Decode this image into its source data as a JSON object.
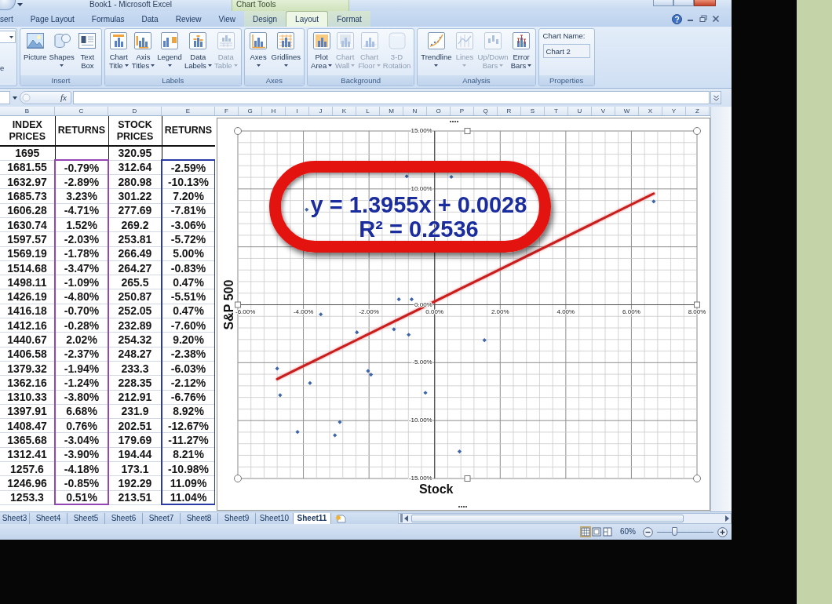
{
  "window": {
    "title": "Book1 - Microsoft Excel",
    "context_group": "Chart Tools"
  },
  "tabs": [
    {
      "label": "sert",
      "selected": false,
      "contextual": false
    },
    {
      "label": "Page Layout",
      "selected": false,
      "contextual": false
    },
    {
      "label": "Formulas",
      "selected": false,
      "contextual": false
    },
    {
      "label": "Data",
      "selected": false,
      "contextual": false
    },
    {
      "label": "Review",
      "selected": false,
      "contextual": false
    },
    {
      "label": "View",
      "selected": false,
      "contextual": false
    },
    {
      "label": "Design",
      "selected": false,
      "contextual": true
    },
    {
      "label": "Layout",
      "selected": true,
      "contextual": true
    },
    {
      "label": "Format",
      "selected": false,
      "contextual": true
    }
  ],
  "ribbon": {
    "cut_group": {
      "text": "e"
    },
    "groups": [
      {
        "label": "Insert",
        "buttons": [
          {
            "label": "Picture",
            "dropdown": false,
            "disabled": false
          },
          {
            "label": "Shapes",
            "dropdown": true,
            "disabled": false
          },
          {
            "label": "Text Box",
            "dropdown": false,
            "disabled": false
          }
        ]
      },
      {
        "label": "Labels",
        "buttons": [
          {
            "label": "Chart Title",
            "dropdown": true,
            "disabled": false
          },
          {
            "label": "Axis Titles",
            "dropdown": true,
            "disabled": false
          },
          {
            "label": "Legend",
            "dropdown": true,
            "disabled": false
          },
          {
            "label": "Data Labels",
            "dropdown": true,
            "disabled": false
          },
          {
            "label": "Data Table",
            "dropdown": true,
            "disabled": true
          }
        ]
      },
      {
        "label": "Axes",
        "buttons": [
          {
            "label": "Axes",
            "dropdown": true,
            "disabled": false
          },
          {
            "label": "Gridlines",
            "dropdown": true,
            "disabled": false
          }
        ]
      },
      {
        "label": "Background",
        "buttons": [
          {
            "label": "Plot Area",
            "dropdown": true,
            "disabled": false
          },
          {
            "label": "Chart Wall",
            "dropdown": true,
            "disabled": true
          },
          {
            "label": "Chart Floor",
            "dropdown": true,
            "disabled": true
          },
          {
            "label": "3-D Rotation",
            "dropdown": false,
            "disabled": true
          }
        ]
      },
      {
        "label": "Analysis",
        "buttons": [
          {
            "label": "Trendline",
            "dropdown": true,
            "disabled": false
          },
          {
            "label": "Lines",
            "dropdown": true,
            "disabled": true
          },
          {
            "label": "Up/Down Bars",
            "dropdown": true,
            "disabled": true
          },
          {
            "label": "Error Bars",
            "dropdown": true,
            "disabled": false
          }
        ]
      }
    ],
    "properties": {
      "label": "Properties",
      "field_label": "Chart Name:",
      "value": "Chart 2"
    }
  },
  "formula_bar": {
    "function_label": "fx"
  },
  "column_headers": [
    "B",
    "C",
    "D",
    "E",
    "F",
    "G",
    "H",
    "I",
    "J",
    "K",
    "L",
    "M",
    "N",
    "O",
    "P",
    "Q",
    "R",
    "S",
    "T",
    "U",
    "V",
    "W",
    "X",
    "Y",
    "Z"
  ],
  "table": {
    "columns": [
      {
        "label": "INDEX PRICES"
      },
      {
        "label": "RETURNS",
        "color": "#9446b4"
      },
      {
        "label": "STOCK PRICES"
      },
      {
        "label": "RETURNS",
        "color": "#2a3aa6"
      }
    ],
    "rows": [
      [
        "1695",
        null,
        "320.95",
        null
      ],
      [
        "1681.55",
        "-0.79%",
        "312.64",
        "-2.59%"
      ],
      [
        "1632.97",
        "-2.89%",
        "280.98",
        "-10.13%"
      ],
      [
        "1685.73",
        "3.23%",
        "301.22",
        "7.20%"
      ],
      [
        "1606.28",
        "-4.71%",
        "277.69",
        "-7.81%"
      ],
      [
        "1630.74",
        "1.52%",
        "269.2",
        "-3.06%"
      ],
      [
        "1597.57",
        "-2.03%",
        "253.81",
        "-5.72%"
      ],
      [
        "1569.19",
        "-1.78%",
        "266.49",
        "5.00%"
      ],
      [
        "1514.68",
        "-3.47%",
        "264.27",
        "-0.83%"
      ],
      [
        "1498.11",
        "-1.09%",
        "265.5",
        "0.47%"
      ],
      [
        "1426.19",
        "-4.80%",
        "250.87",
        "-5.51%"
      ],
      [
        "1416.18",
        "-0.70%",
        "252.05",
        "0.47%"
      ],
      [
        "1412.16",
        "-0.28%",
        "232.89",
        "-7.60%"
      ],
      [
        "1440.67",
        "2.02%",
        "254.32",
        "9.20%"
      ],
      [
        "1406.58",
        "-2.37%",
        "248.27",
        "-2.38%"
      ],
      [
        "1379.32",
        "-1.94%",
        "233.3",
        "-6.03%"
      ],
      [
        "1362.16",
        "-1.24%",
        "228.35",
        "-2.12%"
      ],
      [
        "1310.33",
        "-3.80%",
        "212.91",
        "-6.76%"
      ],
      [
        "1397.91",
        "6.68%",
        "231.9",
        "8.92%"
      ],
      [
        "1408.47",
        "0.76%",
        "202.51",
        "-12.67%"
      ],
      [
        "1365.68",
        "-3.04%",
        "179.69",
        "-11.27%"
      ],
      [
        "1312.41",
        "-3.90%",
        "194.44",
        "8.21%"
      ],
      [
        "1257.6",
        "-4.18%",
        "173.1",
        "-10.98%"
      ],
      [
        "1246.96",
        "-0.85%",
        "192.29",
        "11.09%"
      ],
      [
        "1253.3",
        "0.51%",
        "213.51",
        "11.04%"
      ]
    ]
  },
  "chart": {
    "chart_data": {
      "type": "scatter",
      "xlabel": "Stock",
      "ylabel": "S&P 500",
      "grid": true,
      "x": [
        -0.79,
        -2.89,
        -4.71,
        1.52,
        -2.03,
        -3.47,
        -1.09,
        -4.8,
        -0.7,
        -0.28,
        -2.37,
        -1.94,
        -1.24,
        -3.8,
        6.68,
        0.76,
        -3.04,
        -3.9,
        -4.18,
        -0.85,
        0.51
      ],
      "series": [
        {
          "type": "scatter",
          "color": "#3d65a8",
          "values": [
            -2.59,
            -10.13,
            -7.81,
            -3.06,
            -5.72,
            -0.83,
            0.47,
            -5.51,
            0.47,
            -7.6,
            -2.38,
            -6.03,
            -2.12,
            -6.76,
            8.92,
            -12.67,
            -11.27,
            8.21,
            -10.98,
            11.09,
            11.04
          ]
        },
        {
          "type": "line",
          "color": "#c81e1e",
          "values": [
            -0.82,
            -3.75,
            -6.29,
            2.4,
            -2.55,
            -4.56,
            -1.24,
            -6.42,
            -0.7,
            -0.11,
            -3.03,
            -2.43,
            -1.45,
            -5.02,
            9.6,
            1.34,
            -3.96,
            -5.16,
            -5.55,
            -0.91,
            0.99
          ]
        }
      ],
      "xlim": [
        -6,
        8
      ],
      "ylim": [
        -15,
        15
      ],
      "xticks": [
        {
          "value": -6,
          "label": "-6.00%"
        },
        {
          "value": -4,
          "label": "-4.00%"
        },
        {
          "value": -2,
          "label": "-2.00%"
        },
        {
          "value": 0,
          "label": "0.00%"
        },
        {
          "value": 2,
          "label": "2.00%"
        },
        {
          "value": 4,
          "label": "4.00%"
        },
        {
          "value": 6,
          "label": "6.00%"
        },
        {
          "value": 8,
          "label": "8.00%"
        }
      ],
      "yticks": [
        {
          "value": 15,
          "label": "15.00%"
        },
        {
          "value": 10,
          "label": "10.00%"
        },
        {
          "value": 0,
          "label": "0.00%"
        },
        {
          "value": -5,
          "label": "-5.00%"
        },
        {
          "value": -10,
          "label": "-10.00%"
        },
        {
          "value": -15,
          "label": "-15.00%"
        }
      ]
    },
    "callout": {
      "lines": [
        "y = 1.3955x + 0.0028",
        "R² = 0.2536"
      ]
    }
  },
  "sheet_tabs": [
    {
      "label": "Sheet3",
      "selected": false
    },
    {
      "label": "Sheet4",
      "selected": false
    },
    {
      "label": "Sheet5",
      "selected": false
    },
    {
      "label": "Sheet6",
      "selected": false
    },
    {
      "label": "Sheet7",
      "selected": false
    },
    {
      "label": "Sheet8",
      "selected": false
    },
    {
      "label": "Sheet9",
      "selected": false
    },
    {
      "label": "Sheet10",
      "selected": false
    },
    {
      "label": "Sheet11",
      "selected": true
    }
  ],
  "status_bar": {
    "views": [
      {
        "selected": true
      },
      {
        "selected": false
      },
      {
        "selected": false
      }
    ],
    "zoom": {
      "label": "60%",
      "level": 0.31
    }
  }
}
